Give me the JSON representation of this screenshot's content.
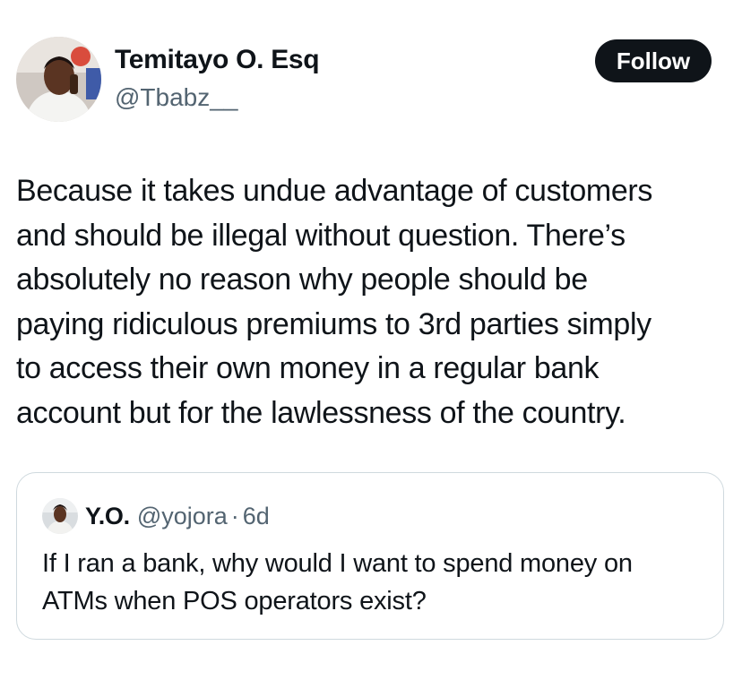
{
  "author": {
    "name": "Temitayo O. Esq",
    "handle": "@Tbabz__"
  },
  "follow_label": "Follow",
  "tweet": {
    "lines": [
      "Because it takes undue advantage of customers",
      "and should be illegal without question. There’s",
      "absolutely no reason why people should be",
      "paying ridiculous premiums to 3rd parties simply",
      "to access their own money in a regular bank",
      "account but for the lawlessness of the country."
    ]
  },
  "quote": {
    "name": "Y.O.",
    "handle": "@yojora",
    "separator": "·",
    "time": "6d",
    "lines": [
      "If I ran a bank, why would I want to spend money on",
      "ATMs when POS operators exist?"
    ]
  },
  "colors": {
    "text": "#0f1419",
    "secondary": "#536471",
    "border": "#cfd9de",
    "button_bg": "#0f1419"
  }
}
